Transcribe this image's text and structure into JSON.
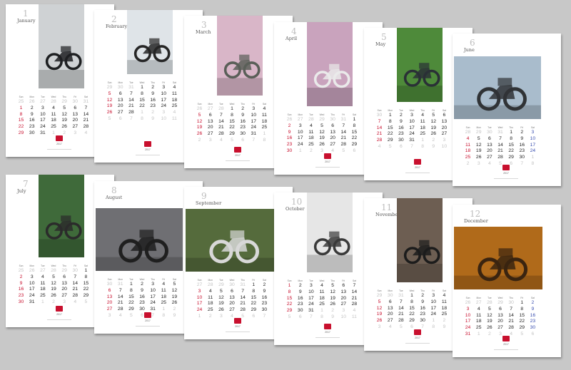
{
  "weekdays": [
    "Sun",
    "Mon",
    "Tue",
    "Wed",
    "Thu",
    "Fri",
    "Sat"
  ],
  "year": "2017",
  "months": [
    {
      "num": "1",
      "name": "January",
      "sat_blue": false,
      "o1": [
        25,
        26,
        27,
        28,
        29,
        30,
        31
      ],
      "n": 31,
      "f": 0,
      "o2": [
        1,
        2,
        3,
        4,
        5,
        6,
        7,
        8,
        9,
        10,
        11
      ],
      "photo": {
        "bg": "#cfd2d4",
        "fg": "#1e2022",
        "kind": "portrait"
      }
    },
    {
      "num": "2",
      "name": "February",
      "sat_blue": false,
      "o1": [
        29,
        30,
        31
      ],
      "n": 28,
      "f": 3,
      "o2": [
        1,
        2,
        3,
        4,
        5,
        6,
        7,
        8,
        9,
        10,
        11
      ],
      "photo": {
        "bg": "#dfe4e8",
        "fg": "#262626",
        "kind": "portrait"
      }
    },
    {
      "num": "3",
      "name": "March",
      "sat_blue": false,
      "o1": [
        26,
        27,
        28
      ],
      "n": 31,
      "f": 3,
      "o2": [
        1,
        2,
        3,
        4,
        5,
        6,
        7,
        8
      ],
      "photo": {
        "bg": "#d9b6c8",
        "fg": "#5a5f58",
        "kind": "portrait"
      }
    },
    {
      "num": "4",
      "name": "April",
      "sat_blue": false,
      "o1": [
        26,
        27,
        28,
        29,
        30,
        31
      ],
      "n": 30,
      "f": 6,
      "o2": [
        1,
        2,
        3,
        4,
        5,
        6
      ],
      "photo": {
        "bg": "#c9a3bd",
        "fg": "#eaeaea",
        "kind": "portrait"
      }
    },
    {
      "num": "5",
      "name": "May",
      "sat_blue": false,
      "o1": [
        30
      ],
      "n": 31,
      "f": 1,
      "o2": [
        1,
        2,
        3,
        4,
        5,
        6,
        7,
        8,
        9,
        10
      ],
      "photo": {
        "bg": "#4e8a3a",
        "fg": "#2a3036",
        "kind": "portrait"
      }
    },
    {
      "num": "6",
      "name": "June",
      "sat_blue": true,
      "o1": [
        28,
        29,
        30,
        31
      ],
      "n": 30,
      "f": 4,
      "o2": [
        1,
        2,
        3,
        4,
        5,
        6,
        7,
        8
      ],
      "photo": {
        "bg": "#a9bccc",
        "fg": "#303336",
        "kind": "landscape"
      }
    },
    {
      "num": "7",
      "name": "July",
      "sat_blue": false,
      "o1": [
        25,
        26,
        27,
        28,
        29,
        30
      ],
      "n": 31,
      "f": 6,
      "o2": [
        1,
        2,
        3,
        4,
        5
      ],
      "photo": {
        "bg": "#3f6a3a",
        "fg": "#2b2b2b",
        "kind": "portrait"
      }
    },
    {
      "num": "8",
      "name": "August",
      "sat_blue": false,
      "o1": [
        30,
        31
      ],
      "n": 31,
      "f": 2,
      "o2": [
        1,
        2,
        3,
        4,
        5,
        6,
        7,
        8,
        9
      ],
      "photo": {
        "bg": "#6f6f73",
        "fg": "#1f1f1f",
        "kind": "landscape"
      }
    },
    {
      "num": "9",
      "name": "September",
      "sat_blue": false,
      "o1": [
        27,
        28,
        29,
        30,
        31
      ],
      "n": 30,
      "f": 5,
      "o2": [
        1,
        2,
        3,
        4,
        5,
        6,
        7
      ],
      "photo": {
        "bg": "#556b3c",
        "fg": "#d8d8d8",
        "kind": "landscape"
      }
    },
    {
      "num": "10",
      "name": "October",
      "sat_blue": false,
      "o1": [],
      "n": 31,
      "f": 0,
      "o2": [
        1,
        2,
        3,
        4,
        5,
        6,
        7,
        8,
        9,
        10,
        11
      ],
      "photo": {
        "bg": "#e6e6e6",
        "fg": "#3a3a3a",
        "kind": "portrait"
      }
    },
    {
      "num": "11",
      "name": "November",
      "sat_blue": false,
      "o1": [
        29,
        30,
        31
      ],
      "n": 30,
      "f": 3,
      "o2": [
        1,
        2,
        3,
        4,
        5,
        6,
        7,
        8,
        9
      ],
      "photo": {
        "bg": "#6d5e52",
        "fg": "#1c1c1c",
        "kind": "portrait"
      }
    },
    {
      "num": "12",
      "name": "December",
      "sat_blue": true,
      "o1": [
        26,
        27,
        28,
        29,
        30
      ],
      "n": 31,
      "f": 5,
      "o2": [
        1,
        2,
        3,
        4,
        5,
        6
      ],
      "photo": {
        "bg": "#b06a1a",
        "fg": "#3a2410",
        "kind": "landscape"
      }
    }
  ]
}
